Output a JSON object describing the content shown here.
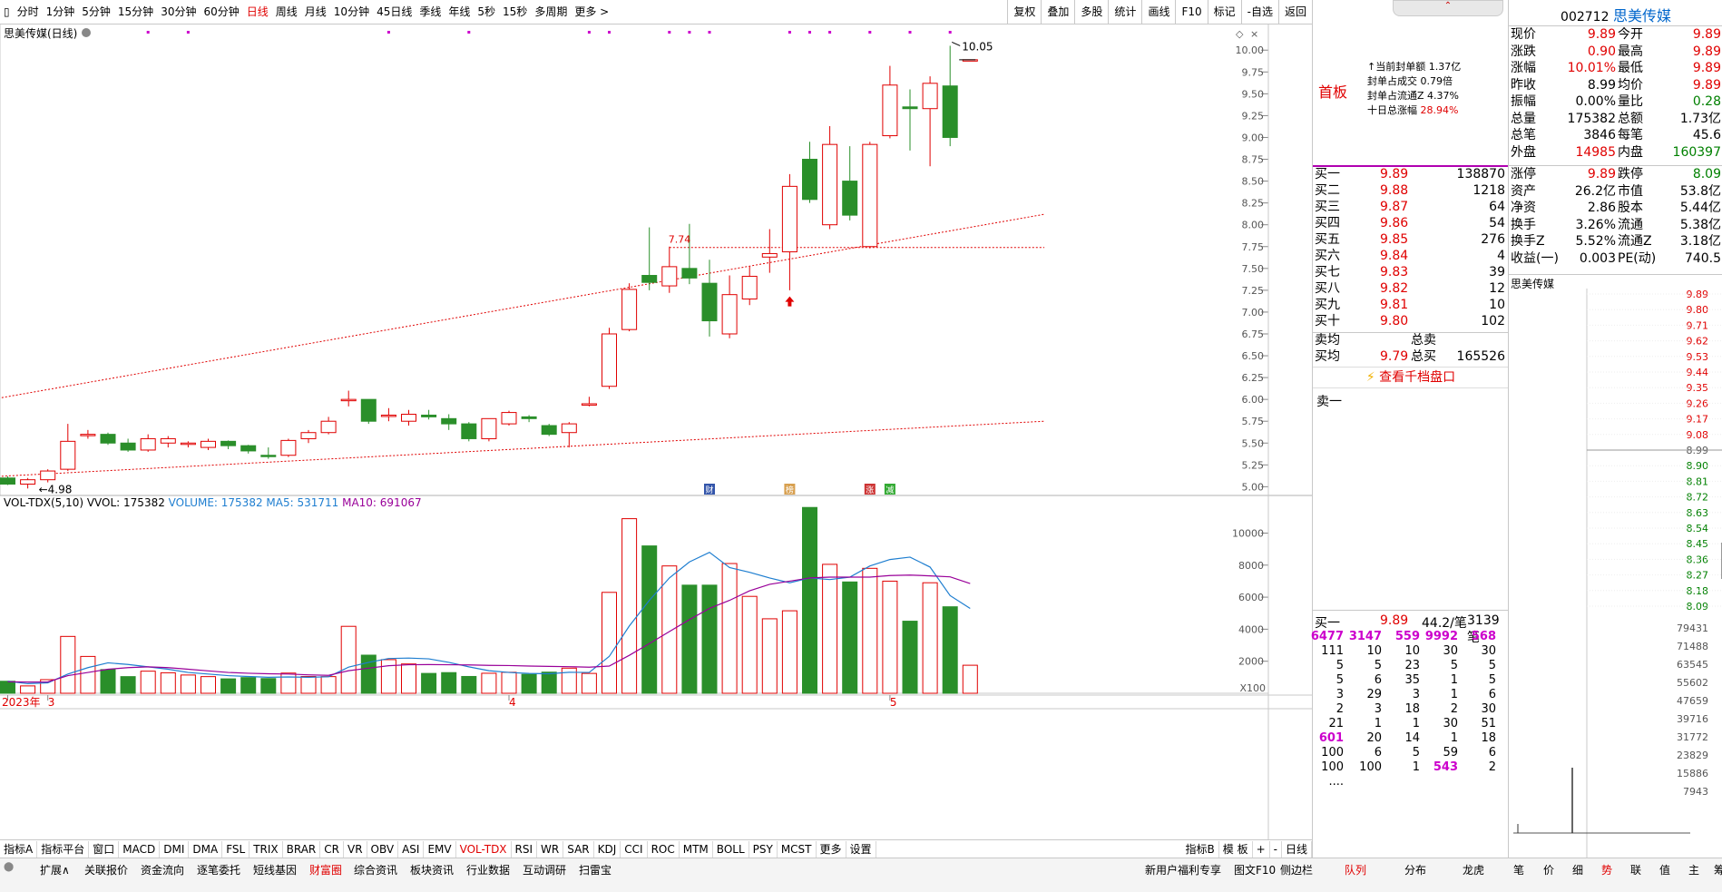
{
  "periods": [
    "分时",
    "1分钟",
    "5分钟",
    "15分钟",
    "30分钟",
    "60分钟",
    "日线",
    "周线",
    "月线",
    "10分钟",
    "45日线",
    "季线",
    "年线",
    "5秒",
    "15秒",
    "多周期",
    "更多 >"
  ],
  "period_active": "日线",
  "tools": [
    "复权",
    "叠加",
    "多股",
    "统计",
    "画线",
    "F10",
    "标记",
    "-自选",
    "返回"
  ],
  "stock_label": "思美传媒(日线)",
  "vol_label": {
    "name": "VOL-TDX(5,10)",
    "vvol": "VVOL: 175382",
    "volume": "VOLUME: 175382",
    "ma5": "MA5: 531711",
    "ma10": "MA10: 691067"
  },
  "ann": {
    "high": "10.05",
    "low": "4.98",
    "mid": "7.74"
  },
  "x_ticks": [
    {
      "i": 0,
      "label": "2023年"
    },
    {
      "i": 2,
      "label": "3"
    },
    {
      "i": 25,
      "label": "4"
    },
    {
      "i": 44,
      "label": "5"
    }
  ],
  "x100": "X100",
  "event_icons": [
    {
      "i": 35,
      "label": "财",
      "color": "#3355aa"
    },
    {
      "i": 39,
      "label": "榜",
      "color": "#d8a050"
    },
    {
      "i": 43,
      "label": "涨",
      "color": "#cc3333"
    },
    {
      "i": 44,
      "label": "减",
      "color": "#33aa33"
    }
  ],
  "ind_tabs": [
    "指标A",
    "指标平台",
    "窗口",
    "MACD",
    "DMI",
    "DMA",
    "FSL",
    "TRIX",
    "BRAR",
    "CR",
    "VR",
    "OBV",
    "ASI",
    "EMV",
    "VOL-TDX",
    "RSI",
    "WR",
    "SAR",
    "KDJ",
    "CCI",
    "ROC",
    "MTM",
    "BOLL",
    "PSY",
    "MCST",
    "更多",
    "设置"
  ],
  "ind_active": "VOL-TDX",
  "ind_right": [
    "指标B",
    "模 板",
    "+",
    "-",
    "日线"
  ],
  "bottom_tabs": [
    "扩展∧",
    "关联报价",
    "资金流向",
    "逐笔委托",
    "短线基因",
    "财富圈",
    "综合资讯",
    "板块资讯",
    "行业数据",
    "互动调研",
    "扫雷宝"
  ],
  "bottom_active": "财富圈",
  "bottom_right": [
    "新用户福利专享",
    "图文F10",
    "侧边栏",
    "队列",
    "分布",
    "龙虎",
    "笔",
    "价",
    "细",
    "势",
    "联",
    "值",
    "主",
    "筹"
  ],
  "mid": {
    "board": "首板",
    "info": [
      [
        "↑当前封单额",
        "1.37亿"
      ],
      [
        "封单占成交",
        "0.79倍"
      ],
      [
        "封单占流通Z",
        "4.37%"
      ],
      [
        "十日总涨幅",
        "28.94%"
      ]
    ],
    "bids": [
      [
        "买一",
        "9.89",
        "138870"
      ],
      [
        "买二",
        "9.88",
        "1218"
      ],
      [
        "买三",
        "9.87",
        "64"
      ],
      [
        "买四",
        "9.86",
        "54"
      ],
      [
        "买五",
        "9.85",
        "276"
      ],
      [
        "买六",
        "9.84",
        "4"
      ],
      [
        "买七",
        "9.83",
        "39"
      ],
      [
        "买八",
        "9.82",
        "12"
      ],
      [
        "买九",
        "9.81",
        "10"
      ],
      [
        "买十",
        "9.80",
        "102"
      ]
    ],
    "avg": [
      [
        "卖均",
        "",
        "总卖",
        ""
      ],
      [
        "买均",
        "9.79",
        "总买",
        "165526"
      ]
    ],
    "view_more": "查看千档盘口",
    "sell1": "卖一",
    "queue_head": [
      "买一",
      "9.89",
      "44.2/笔",
      "3139笔"
    ],
    "queue": [
      [
        "6477",
        "3147",
        "559",
        "9992",
        "568"
      ],
      [
        "111",
        "10",
        "10",
        "30",
        "30"
      ],
      [
        "5",
        "5",
        "23",
        "5",
        "5"
      ],
      [
        "5",
        "6",
        "35",
        "1",
        "5"
      ],
      [
        "3",
        "29",
        "3",
        "1",
        "6"
      ],
      [
        "2",
        "3",
        "18",
        "2",
        "30"
      ],
      [
        "21",
        "1",
        "1",
        "30",
        "51"
      ],
      [
        "601",
        "20",
        "14",
        "1",
        "18"
      ],
      [
        "100",
        "6",
        "5",
        "59",
        "6"
      ],
      [
        "100",
        "100",
        "1",
        "543",
        "2"
      ],
      [
        "....",
        "",
        "",
        "",
        ""
      ]
    ]
  },
  "right": {
    "code": "002712",
    "name": "思美传媒",
    "quote": [
      [
        "现价",
        "9.89",
        "今开",
        "9.89"
      ],
      [
        "涨跌",
        "0.90",
        "最高",
        "9.89"
      ],
      [
        "涨幅",
        "10.01%",
        "最低",
        "9.89"
      ],
      [
        "昨收",
        "8.99",
        "均价",
        "9.89"
      ],
      [
        "振幅",
        "0.00%",
        "量比",
        "0.28"
      ],
      [
        "总量",
        "175382",
        "总额",
        "1.73亿"
      ],
      [
        "总笔",
        "3846",
        "每笔",
        "45.6"
      ],
      [
        "外盘",
        "14985",
        "内盘",
        "160397"
      ]
    ],
    "fund": [
      [
        "涨停",
        "9.89",
        "跌停",
        "8.09"
      ],
      [
        "资产",
        "26.2亿",
        "市值",
        "53.8亿"
      ],
      [
        "净资",
        "2.86",
        "股本",
        "5.44亿"
      ],
      [
        "换手",
        "3.26%",
        "流通",
        "5.38亿"
      ],
      [
        "换手Z",
        "5.52%",
        "流通Z",
        "3.18亿"
      ],
      [
        "收益(一)",
        "0.003",
        "PE(动)",
        "740.5"
      ]
    ],
    "mini_title": "思美传媒",
    "mini_prices": [
      "9.89",
      "9.80",
      "9.71",
      "9.62",
      "9.53",
      "9.44",
      "9.35",
      "9.26",
      "9.17",
      "9.08",
      "8.99",
      "8.90",
      "8.81",
      "8.72",
      "8.63",
      "8.54",
      "8.45",
      "8.36",
      "8.27",
      "8.18",
      "8.09"
    ],
    "mini_vols": [
      "79431",
      "71488",
      "63545",
      "55602",
      "47659",
      "39716",
      "31772",
      "23829",
      "15886",
      "7943"
    ]
  },
  "chart_data": {
    "type": "candlestick",
    "title": "思美传媒(日线)",
    "ylim": [
      4.9,
      10.2
    ],
    "yticks": [
      5.0,
      5.25,
      5.5,
      5.75,
      6.0,
      6.25,
      6.5,
      6.75,
      7.0,
      7.25,
      7.5,
      7.75,
      8.0,
      8.25,
      8.5,
      8.75,
      9.0,
      9.25,
      9.5,
      9.75,
      10.0
    ],
    "candles": [
      [
        5.1,
        5.03,
        5.12,
        5.02
      ],
      [
        5.03,
        5.08,
        5.1,
        4.98
      ],
      [
        5.08,
        5.18,
        5.2,
        5.05
      ],
      [
        5.2,
        5.52,
        5.72,
        5.18
      ],
      [
        5.6,
        5.6,
        5.65,
        5.55
      ],
      [
        5.6,
        5.5,
        5.62,
        5.48
      ],
      [
        5.5,
        5.42,
        5.55,
        5.4
      ],
      [
        5.42,
        5.55,
        5.6,
        5.4
      ],
      [
        5.5,
        5.55,
        5.58,
        5.45
      ],
      [
        5.5,
        5.5,
        5.52,
        5.45
      ],
      [
        5.45,
        5.52,
        5.55,
        5.42
      ],
      [
        5.52,
        5.47,
        5.53,
        5.43
      ],
      [
        5.47,
        5.41,
        5.48,
        5.38
      ],
      [
        5.36,
        5.35,
        5.45,
        5.32
      ],
      [
        5.36,
        5.53,
        5.55,
        5.34
      ],
      [
        5.55,
        5.62,
        5.65,
        5.5
      ],
      [
        5.62,
        5.75,
        5.8,
        5.6
      ],
      [
        6.0,
        6.0,
        6.1,
        5.92
      ],
      [
        6.0,
        5.75,
        6.0,
        5.72
      ],
      [
        5.82,
        5.82,
        5.9,
        5.75
      ],
      [
        5.75,
        5.83,
        5.88,
        5.7
      ],
      [
        5.82,
        5.8,
        5.88,
        5.77
      ],
      [
        5.78,
        5.72,
        5.83,
        5.65
      ],
      [
        5.72,
        5.55,
        5.74,
        5.52
      ],
      [
        5.55,
        5.78,
        5.78,
        5.52
      ],
      [
        5.72,
        5.85,
        5.87,
        5.7
      ],
      [
        5.8,
        5.78,
        5.82,
        5.74
      ],
      [
        5.7,
        5.6,
        5.72,
        5.58
      ],
      [
        5.62,
        5.72,
        5.74,
        5.45
      ],
      [
        5.95,
        5.95,
        6.03,
        5.92
      ],
      [
        6.15,
        6.75,
        6.82,
        6.12
      ],
      [
        6.8,
        7.26,
        7.33,
        6.78
      ],
      [
        7.42,
        7.34,
        7.97,
        7.25
      ],
      [
        7.3,
        7.52,
        7.75,
        7.22
      ],
      [
        7.5,
        7.39,
        8.01,
        7.32
      ],
      [
        7.33,
        6.9,
        7.6,
        6.72
      ],
      [
        6.75,
        7.2,
        7.42,
        6.7
      ],
      [
        7.15,
        7.41,
        7.52,
        7.08
      ],
      [
        7.63,
        7.67,
        7.95,
        7.45
      ],
      [
        7.69,
        8.44,
        8.58,
        7.25
      ],
      [
        8.75,
        8.29,
        8.95,
        8.25
      ],
      [
        8.0,
        8.92,
        9.13,
        7.95
      ],
      [
        8.5,
        8.11,
        8.9,
        8.05
      ],
      [
        7.75,
        8.92,
        8.95,
        7.73
      ],
      [
        9.02,
        9.6,
        9.82,
        8.99
      ],
      [
        9.35,
        9.33,
        9.55,
        8.85
      ],
      [
        9.33,
        9.62,
        9.7,
        8.67
      ],
      [
        9.59,
        9.0,
        10.05,
        8.9
      ],
      [
        9.89,
        9.89,
        9.89,
        9.89
      ]
    ],
    "volume": {
      "ymax": 11500,
      "yticks": [
        2000,
        4000,
        6000,
        8000,
        10000
      ],
      "values": [
        750,
        460,
        850,
        3550,
        2300,
        1480,
        1040,
        1380,
        1280,
        1140,
        1040,
        900,
        980,
        920,
        1260,
        1050,
        1040,
        4180,
        2380,
        2100,
        1830,
        1240,
        1290,
        1050,
        1250,
        1310,
        1180,
        1320,
        1570,
        1240,
        6300,
        10900,
        9200,
        7950,
        6750,
        6750,
        8100,
        6050,
        4650,
        5150,
        11600,
        8050,
        6950,
        7800,
        7000,
        4500,
        6900,
        5400,
        1750
      ],
      "ma5": [
        750,
        600,
        650,
        1200,
        1600,
        1900,
        1800,
        1650,
        1500,
        1300,
        1200,
        1100,
        1050,
        1000,
        1020,
        1000,
        1030,
        1630,
        1930,
        2170,
        2200,
        2150,
        1930,
        1650,
        1410,
        1300,
        1240,
        1220,
        1310,
        1300,
        2300,
        4200,
        5800,
        7200,
        8200,
        8800,
        7850,
        7550,
        7200,
        6900,
        7200,
        7100,
        7250,
        7950,
        8350,
        8500,
        7880,
        6100,
        5300
      ],
      "ma10": [
        720,
        700,
        710,
        1100,
        1300,
        1500,
        1600,
        1650,
        1600,
        1500,
        1400,
        1300,
        1250,
        1220,
        1200,
        1150,
        1120,
        1410,
        1570,
        1720,
        1780,
        1790,
        1780,
        1770,
        1740,
        1730,
        1700,
        1680,
        1660,
        1630,
        1700,
        2370,
        3100,
        3850,
        4600,
        5300,
        5800,
        6400,
        6800,
        7000,
        7200,
        7250,
        7250,
        7250,
        7350,
        7380,
        7330,
        7270,
        6850
      ]
    },
    "trendlines": [
      {
        "from": [
          -0.3,
          6.02
        ],
        "to": [
          51.7,
          8.12
        ]
      },
      {
        "from": [
          -0.3,
          5.12
        ],
        "to": [
          51.7,
          5.75
        ]
      }
    ],
    "hline": {
      "value": 7.74,
      "from": 33,
      "to": 51.7
    }
  }
}
